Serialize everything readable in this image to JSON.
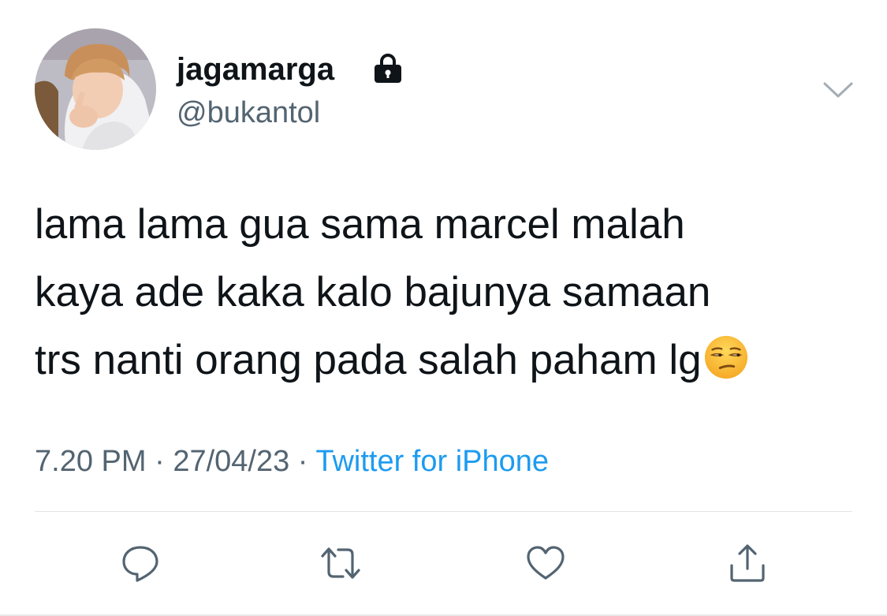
{
  "author": {
    "display_name": "jagamarga",
    "handle": "@bukantol",
    "protected": true
  },
  "tweet": {
    "lines": [
      "lama lama gua sama marcel malah",
      "kaya ade kaka kalo bajunya samaan",
      "trs nanti orang pada salah paham lg"
    ],
    "emoji": "unamused-face"
  },
  "meta": {
    "time": "7.20 PM",
    "separator": "·",
    "date": "27/04/23",
    "source": "Twitter for iPhone"
  },
  "actions": [
    "reply-icon",
    "retweet-icon",
    "like-icon",
    "share-icon"
  ],
  "colors": {
    "text": "#0f1419",
    "secondary": "#536471",
    "link": "#1d9bf0",
    "divider": "#e1e4e8",
    "icon": "#536471"
  }
}
